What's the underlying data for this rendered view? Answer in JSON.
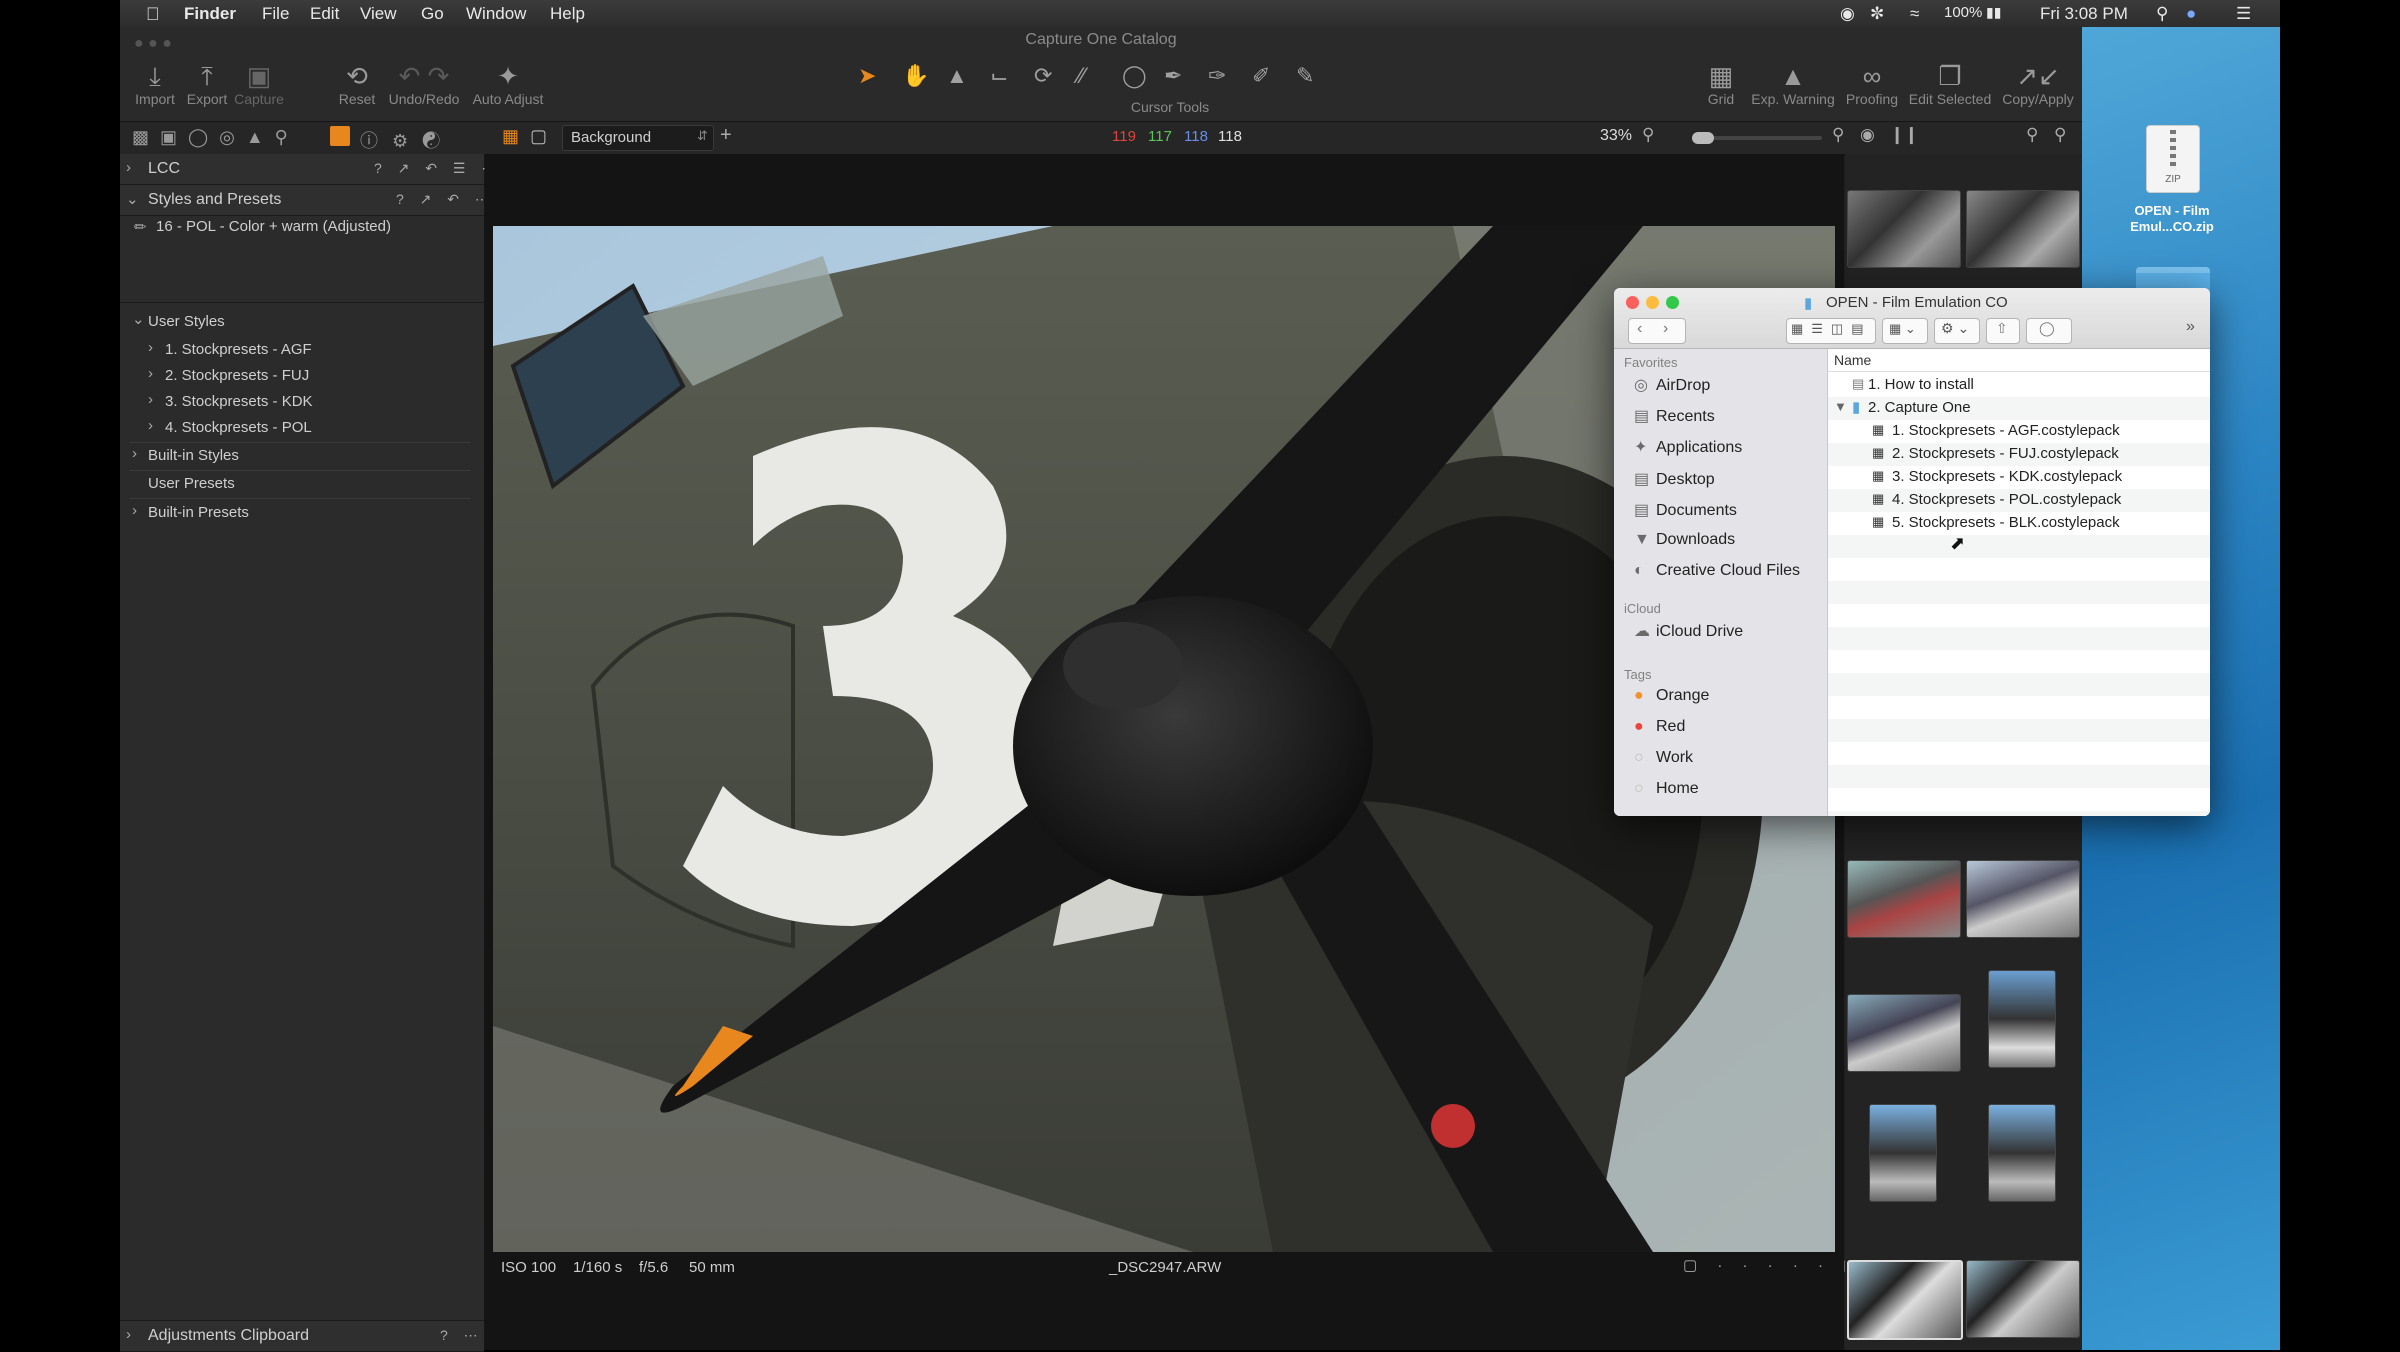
{
  "menubar": {
    "app_name": "Finder",
    "items": [
      "File",
      "Edit",
      "View",
      "Go",
      "Window",
      "Help"
    ],
    "battery": "100%",
    "clock": "Fri 3:08 PM"
  },
  "window": {
    "title": "Capture One Catalog"
  },
  "toolbar": {
    "import": "Import",
    "export": "Export",
    "capture": "Capture",
    "reset": "Reset",
    "undo_redo": "Undo/Redo",
    "auto_adjust": "Auto Adjust",
    "cursor_tools": "Cursor Tools",
    "grid": "Grid",
    "exp_warning": "Exp. Warning",
    "proofing": "Proofing",
    "edit_selected": "Edit Selected",
    "copy_apply": "Copy/Apply"
  },
  "tabbar": {
    "layer": "Background",
    "rgb": {
      "r": "119",
      "g": "117",
      "b": "118",
      "l": "118"
    },
    "zoom": "33%"
  },
  "left": {
    "lcc": "LCC",
    "styles_presets": "Styles and Presets",
    "applied_style": "16 - POL - Color + warm (Adjusted)",
    "user_styles": "User Styles",
    "user_style_items": [
      "1. Stockpresets - AGF",
      "2. Stockpresets - FUJ",
      "3. Stockpresets - KDK",
      "4. Stockpresets - POL"
    ],
    "builtin_styles": "Built-in Styles",
    "user_presets": "User Presets",
    "builtin_presets": "Built-in Presets",
    "adjustments_clipboard": "Adjustments Clipboard"
  },
  "viewer": {
    "iso": "ISO 100",
    "shutter": "1/160 s",
    "aperture": "f/5.6",
    "focal": "50 mm",
    "filename": "_DSC2947.ARW"
  },
  "finder": {
    "title": "OPEN - Film Emulation CO",
    "favorites_header": "Favorites",
    "favorites": [
      "AirDrop",
      "Recents",
      "Applications",
      "Desktop",
      "Documents",
      "Downloads",
      "Creative Cloud Files"
    ],
    "icloud_header": "iCloud",
    "icloud": [
      "iCloud Drive"
    ],
    "tags_header": "Tags",
    "tags": [
      "Orange",
      "Red",
      "Work",
      "Home"
    ],
    "column_name": "Name",
    "files": [
      "1. How to install",
      "2. Capture One",
      "1. Stockpresets - AGF.costylepack",
      "2. Stockpresets - FUJ.costylepack",
      "3. Stockpresets - KDK.costylepack",
      "4. Stockpresets - POL.costylepack",
      "5. Stockpresets - BLK.costylepack"
    ]
  },
  "desktop": {
    "file_label_1": "OPEN - Film",
    "file_label_2": "Emul...CO.zip",
    "zip_badge": "ZIP"
  },
  "colors": {
    "accent_orange": "#e8871e",
    "red_channel": "#e0443c",
    "green_channel": "#5ec45e",
    "blue_channel": "#6a8ee8"
  }
}
